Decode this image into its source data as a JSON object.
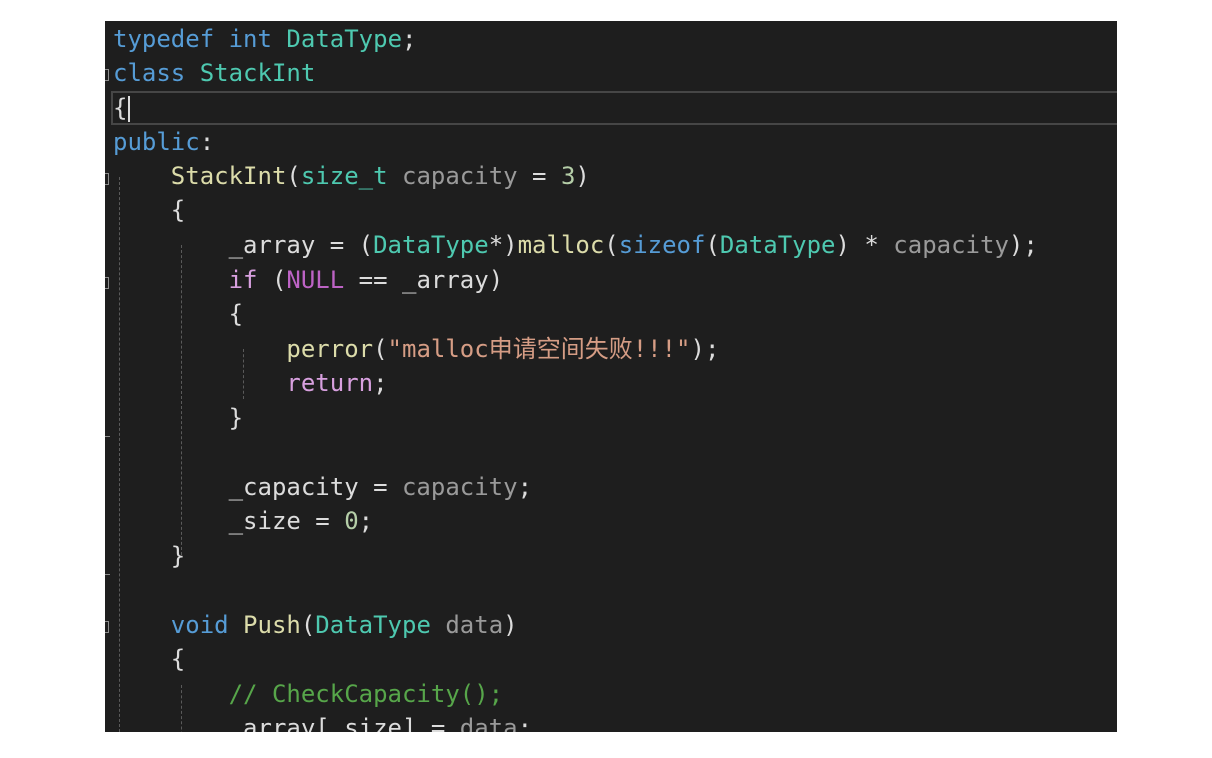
{
  "code": {
    "l1": {
      "t1": "typedef",
      "t2": " ",
      "t3": "int",
      "t4": " ",
      "t5": "DataType",
      "t6": ";"
    },
    "l2": {
      "t1": "class",
      "t2": " ",
      "t3": "StackInt"
    },
    "l3": {
      "t1": "{"
    },
    "l4": {
      "t1": "public",
      "t2": ":"
    },
    "l5": {
      "t1": "    ",
      "t2": "StackInt",
      "t3": "(",
      "t4": "size_t",
      "t5": " ",
      "t6": "capacity",
      "t7": " = ",
      "t8": "3",
      "t9": ")"
    },
    "l6": {
      "t1": "    {"
    },
    "l7": {
      "t1": "        _array = (",
      "t2": "DataType",
      "t3": "*)",
      "t4": "malloc",
      "t5": "(",
      "t6": "sizeof",
      "t7": "(",
      "t8": "DataType",
      "t9": ") * ",
      "t10": "capacity",
      "t11": ");"
    },
    "l8": {
      "t1": "        ",
      "t2": "if",
      "t3": " (",
      "t4": "NULL",
      "t5": " == _array)"
    },
    "l9": {
      "t1": "        {"
    },
    "l10": {
      "t1": "            ",
      "t2": "perror",
      "t3": "(",
      "t4": "\"malloc申请空间失败!!!\"",
      "t5": ");"
    },
    "l11": {
      "t1": "            ",
      "t2": "return",
      "t3": ";"
    },
    "l12": {
      "t1": "        }"
    },
    "l13": {
      "t1": ""
    },
    "l14": {
      "t1": "        _capacity = ",
      "t2": "capacity",
      "t3": ";"
    },
    "l15": {
      "t1": "        _size = ",
      "t2": "0",
      "t3": ";"
    },
    "l16": {
      "t1": "    }"
    },
    "l17": {
      "t1": ""
    },
    "l18": {
      "t1": "    ",
      "t2": "void",
      "t3": " ",
      "t4": "Push",
      "t5": "(",
      "t6": "DataType",
      "t7": " ",
      "t8": "data",
      "t9": ")"
    },
    "l19": {
      "t1": "    {"
    },
    "l20": {
      "t1": "        ",
      "t2": "// CheckCapacity();"
    },
    "l21": {
      "t1": "        _array[_size] = ",
      "t2": "data",
      "t3": ";"
    }
  },
  "colors": {
    "background": "#1e1e1e",
    "keyword": "#569cd6",
    "type": "#4ec9b0",
    "function": "#dcdcaa",
    "parameter": "#9a9a9a",
    "number": "#b5cea8",
    "string": "#d69d85",
    "control": "#d8a0df",
    "comment": "#57a64a",
    "macro": "#bd63c5"
  }
}
